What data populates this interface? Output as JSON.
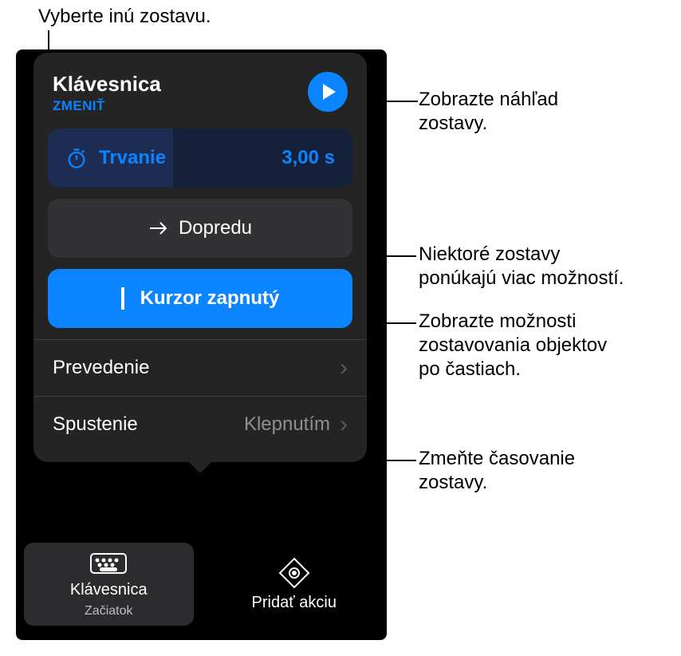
{
  "callouts": {
    "top": "Vyberte inú zostavu.",
    "preview": "Zobrazte náhľad\nzostavy.",
    "options": "Niektoré zostavy\nponúkajú viac možností.",
    "parts": "Zobrazte možnosti\nzostavovania objektov\npo častiach.",
    "timing": "Zmeňte časovanie\nzostavy."
  },
  "popover": {
    "title": "Klávesnica",
    "change_label": "ZMENIŤ",
    "duration": {
      "label": "Trvanie",
      "value": "3,00 s"
    },
    "forward_label": "Dopredu",
    "cursor_label": "Kurzor zapnutý",
    "rows": {
      "delivery": {
        "label": "Prevedenie"
      },
      "start": {
        "label": "Spustenie",
        "value": "Klepnutím"
      }
    }
  },
  "tabs": {
    "selected": {
      "label": "Klávesnica",
      "subtitle": "Začiatok"
    },
    "add": {
      "label": "Pridať akciu"
    }
  }
}
